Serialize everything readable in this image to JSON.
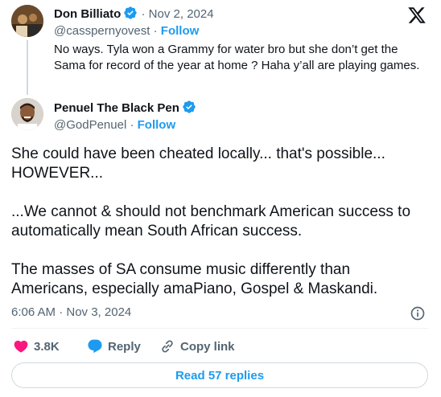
{
  "quoted": {
    "name": "Don Billiato",
    "date": "Nov 2, 2024",
    "handle": "@casspernyovest",
    "follow_label": "Follow",
    "text": "No ways. Tyla won a Grammy for water bro but she don’t get the Sama for record of the year at home ?  Haha y’all are playing games."
  },
  "author": {
    "name": "Penuel The Black Pen",
    "handle": "@GodPenuel",
    "follow_label": "Follow"
  },
  "tweet": {
    "paragraphs": [
      "She could have been cheated locally... that's possible... HOWEVER...",
      "...We cannot & should not benchmark American success to automatically mean South African success.",
      "The masses of SA consume music differently than Americans, especially amaPiano, Gospel & Maskandi."
    ],
    "timestamp": "6:06 AM · Nov 3, 2024"
  },
  "actions": {
    "likes": "3.8K",
    "reply_label": "Reply",
    "copy_label": "Copy link"
  },
  "read_replies_label": "Read 57 replies",
  "colors": {
    "accent": "#1d9bf0",
    "like": "#f91880",
    "secondary_text": "#536471"
  }
}
